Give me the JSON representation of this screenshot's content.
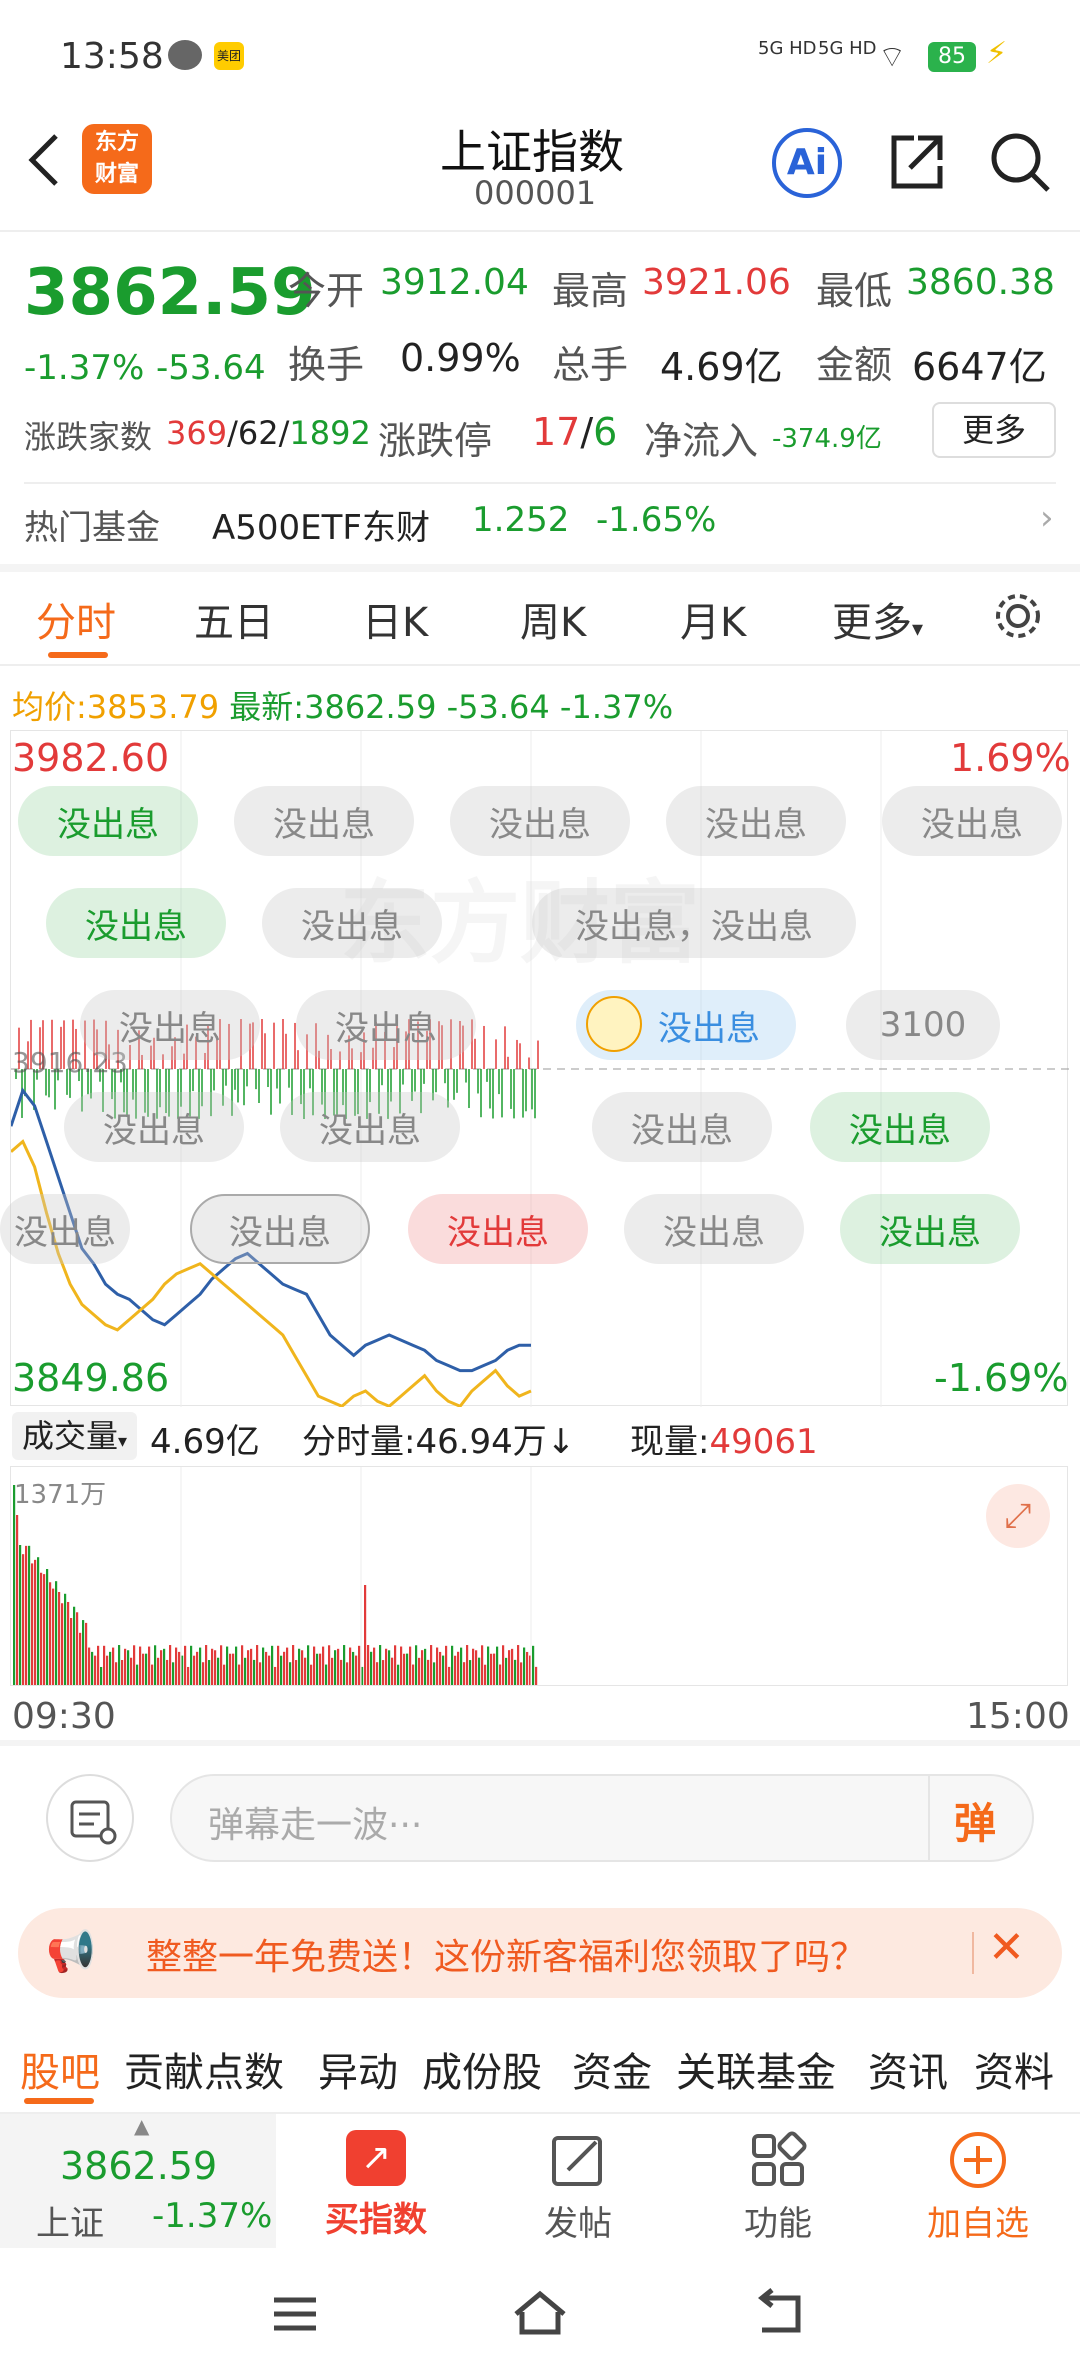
{
  "status": {
    "time": "13:58",
    "battery": "85",
    "signal1": "5G HD",
    "signal2": "5G HD"
  },
  "header": {
    "logo_line1": "东方",
    "logo_line2": "财富",
    "title": "上证指数",
    "code": "000001"
  },
  "quote": {
    "price": "3862.59",
    "change_pct": "-1.37%",
    "change": "-53.64",
    "open_label": "今开",
    "open": "3912.04",
    "high_label": "最高",
    "high": "3921.06",
    "low_label": "最低",
    "low": "3860.38",
    "turnover_label": "换手",
    "turnover": "0.99%",
    "volume_label": "总手",
    "volume": "4.69亿",
    "amount_label": "金额",
    "amount": "6647亿",
    "breadth_label": "涨跌家数",
    "up": "369",
    "flat": "62",
    "down": "1892",
    "limit_label": "涨跌停",
    "limit_up": "17",
    "limit_down": "6",
    "inflow_label": "净流入",
    "inflow": "-374.9亿",
    "more_button": "更多"
  },
  "fund": {
    "label": "热门基金",
    "name": "A500ETF东财",
    "price": "1.252",
    "change": "-1.65%"
  },
  "chart_tabs": [
    "分时",
    "五日",
    "日K",
    "周K",
    "月K",
    "更多"
  ],
  "chart_header": {
    "avg_label": "均价:",
    "avg": "3853.79",
    "last_label": "最新:",
    "last": "3862.59",
    "chg": "-53.64",
    "pct": "-1.37%"
  },
  "chart_labels": {
    "top_price": "3982.60",
    "top_pct": "1.69%",
    "bottom_price": "3849.86",
    "bottom_pct": "-1.69%",
    "mid_price": "3916.23",
    "start_time": "09:30",
    "end_time": "15:00"
  },
  "danmaku": {
    "msg": "没出息",
    "msg_double": "没出息，没出息",
    "msg_3100": "3100"
  },
  "volume_bar": {
    "label": "成交量",
    "total": "4.69亿",
    "tick_label": "分时量:46.94万",
    "cur_label": "现量:",
    "cur": "49061",
    "max": "1371万"
  },
  "comment": {
    "placeholder": "弹幕走一波···",
    "send": "弹"
  },
  "promo": {
    "text": "整整一年免费送！这份新客福利您领取了吗？"
  },
  "bottom_tabs": [
    "股吧",
    "贡献点数",
    "异动",
    "成份股",
    "资金",
    "关联基金",
    "资讯",
    "资料"
  ],
  "nav": {
    "index_price": "3862.59",
    "index_name": "上证",
    "index_pct": "-1.37%",
    "buy": "买指数",
    "post": "发帖",
    "func": "功能",
    "watch": "加自选"
  },
  "colors": {
    "up": "#e23a3a",
    "down": "#1a9c2e",
    "accent": "#f56a1a",
    "price_line": "#2e5fa8",
    "avg_line": "#f0b51d"
  },
  "chart_data": {
    "type": "line",
    "series": [
      {
        "values": [
          3905,
          3912,
          3909,
          3902,
          3895,
          3888,
          3881,
          3878,
          3874,
          3872,
          3871,
          3869,
          3867,
          3866,
          3868,
          3870,
          3872,
          3875,
          3877,
          3879,
          3880,
          3878,
          3876,
          3874,
          3873,
          3872,
          3868,
          3864,
          3862,
          3860,
          3862,
          3863,
          3864,
          3863,
          3862,
          3861,
          3859,
          3858,
          3857,
          3857,
          3858,
          3859,
          3861,
          3862,
          3862
        ]
      },
      {
        "values": [
          3900,
          3902,
          3897,
          3888,
          3880,
          3874,
          3870,
          3868,
          3866,
          3865,
          3867,
          3869,
          3871,
          3874,
          3876,
          3877,
          3878,
          3876,
          3874,
          3872,
          3870,
          3868,
          3866,
          3864,
          3860,
          3856,
          3852,
          3851,
          3850,
          3852,
          3853,
          3851,
          3850,
          3852,
          3854,
          3856,
          3853,
          3851,
          3850,
          3853,
          3855,
          3857,
          3854,
          3852,
          3853
        ]
      }
    ],
    "ylim": [
      3849.86,
      3982.6
    ]
  }
}
